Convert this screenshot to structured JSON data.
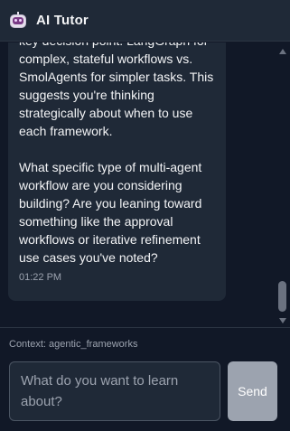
{
  "header": {
    "title": "AI Tutor",
    "icon": "robot-icon"
  },
  "message": {
    "lines": [
      "key decision point: LangGraph for",
      "complex, stateful workflows vs.",
      "SmolAgents for simpler tasks. This",
      "suggests you're thinking",
      "strategically about when to use",
      "each framework."
    ],
    "lines2": [
      "What specific type of multi-agent",
      "workflow are you considering",
      "building? Are you leaning toward",
      "something like the approval",
      "workflows or iterative refinement",
      "use cases you've noted?"
    ],
    "timestamp": "01:22 PM"
  },
  "footer": {
    "context_label": "Context: agentic_frameworks",
    "input_placeholder": "What do you want to learn about?",
    "send_label": "Send"
  },
  "colors": {
    "background": "#111827",
    "panel": "#1f2937",
    "send_button": "#9ca3af"
  }
}
